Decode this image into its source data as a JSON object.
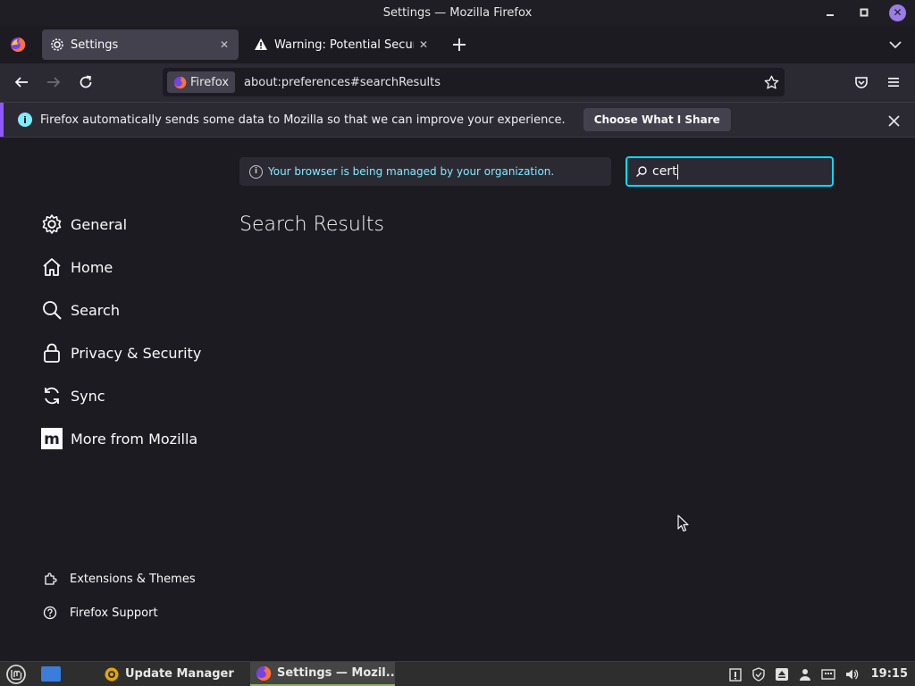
{
  "window": {
    "title": "Settings — Mozilla Firefox"
  },
  "tabs": [
    {
      "label": "Settings",
      "icon": "gear-icon",
      "active": true
    },
    {
      "label": "Warning: Potential Security Risk Ahead",
      "icon": "warning-icon",
      "active": false
    }
  ],
  "urlbar": {
    "identity_label": "Firefox",
    "url": "about:preferences#searchResults"
  },
  "notification": {
    "text": "Firefox automatically sends some data to Mozilla so that we can improve your experience.",
    "button_label": "Choose What I Share",
    "accent_color": "#9059ff"
  },
  "settings": {
    "managed_notice": "Your browser is being managed by your organization.",
    "search_value": "cert",
    "results_title": "Search Results",
    "categories": [
      {
        "label": "General",
        "icon": "gear-icon"
      },
      {
        "label": "Home",
        "icon": "home-icon"
      },
      {
        "label": "Search",
        "icon": "search-icon"
      },
      {
        "label": "Privacy & Security",
        "icon": "lock-icon"
      },
      {
        "label": "Sync",
        "icon": "sync-icon"
      },
      {
        "label": "More from Mozilla",
        "icon": "mozilla-icon"
      }
    ],
    "footer_links": [
      {
        "label": "Extensions & Themes",
        "icon": "puzzle-icon"
      },
      {
        "label": "Firefox Support",
        "icon": "help-icon"
      }
    ]
  },
  "taskbar": {
    "tasks": [
      {
        "label": "Update Manager",
        "icon": "update-manager-icon"
      },
      {
        "label": "Settings — Mozil...",
        "icon": "firefox-icon",
        "active": true
      }
    ],
    "clock": "19:15"
  },
  "colors": {
    "focus_ring": "#00ddff",
    "managed_text": "#80ebff",
    "page_bg": "#1c1b22"
  }
}
